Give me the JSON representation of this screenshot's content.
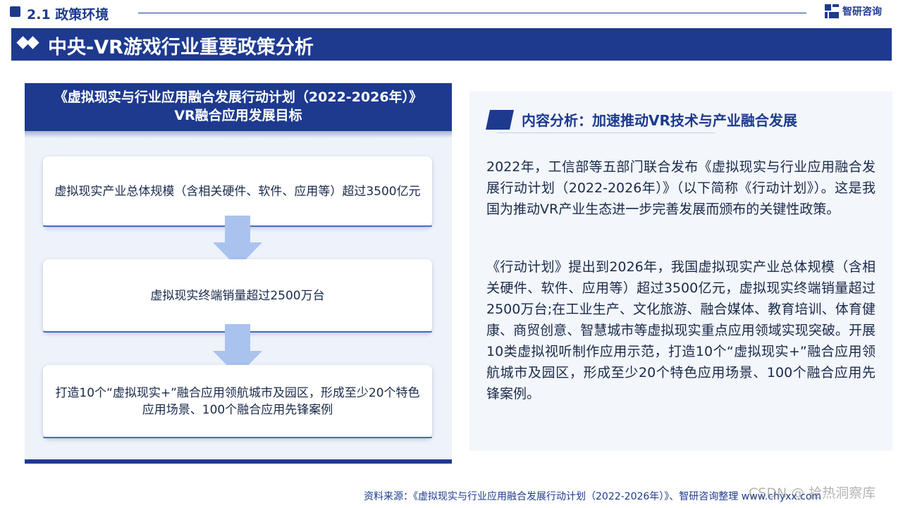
{
  "header": {
    "section_title": "2.1 政策环境",
    "brand_name": "智研咨询",
    "banner_title": "中央-VR游戏行业重要政策分析"
  },
  "left": {
    "header_line1": "《虚拟现实与行业应用融合发展行动计划（2022-2026年）》",
    "header_line2": "VR融合应用发展目标",
    "goals": [
      "虚拟现实产业总体规模（含相关硬件、软件、应用等）超过3500亿元",
      "虚拟现实终端销量超过2500万台",
      "打造10个“虚拟现实+”融合应用领航城市及园区，形成至少20个特色应用场景、100个融合应用先锋案例"
    ]
  },
  "right": {
    "title": "内容分析：加速推动VR技术与产业融合发展",
    "paragraphs": [
      "2022年，工信部等五部门联合发布《虚拟现实与行业应用融合发展行动计划（2022-2026年）》（以下简称《行动计划》）。这是我国为推动VR产业生态进一步完善发展而颁布的关键性政策。",
      "《行动计划》提出到2026年，我国虚拟现实产业总体规模（含相关硬件、软件、应用等）超过3500亿元，虚拟现实终端销量超过2500万台;在工业生产、文化旅游、融合媒体、教育培训、体育健康、商贸创意、智慧城市等虚拟现实重点应用领域实现突破。开展10类虚拟视听制作应用示范，打造10个“虚拟现实+”融合应用领航城市及园区，形成至少20个特色应用场景、100个融合应用先锋案例。"
    ]
  },
  "footer": {
    "source": "资料来源：《虚拟现实与行业应用融合发展行动计划（2022-2026年）》、智研咨询整理 www.chyxx.com",
    "watermark": "CSDN @ 拾热洞察库"
  },
  "colors": {
    "brand_navy": "#1d3a8f",
    "arrow_blue": "#aac2ee",
    "panel_bg": "#eef2f9"
  }
}
